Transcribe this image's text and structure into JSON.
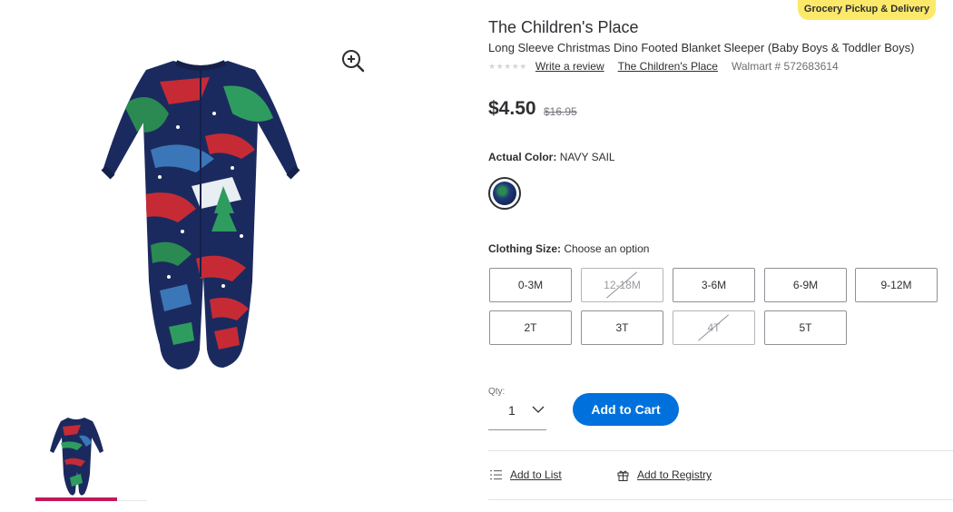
{
  "badges": {
    "grocery": "Grocery Pickup & Delivery"
  },
  "product": {
    "brand": "The Children's Place",
    "title": "Long Sleeve Christmas Dino Footed Blanket Sleeper (Baby Boys & Toddler Boys)",
    "rating_stars": "★★★★★",
    "write_review": "Write a review",
    "brand_link": "The Children's Place",
    "walmart_number": "Walmart # 572683614"
  },
  "pricing": {
    "price": "$4.50",
    "was_price": "$16.95"
  },
  "color": {
    "label": "Actual Color:",
    "value": "NAVY SAIL"
  },
  "size": {
    "label": "Clothing Size:",
    "value": "Choose an option",
    "options": [
      {
        "label": "0-3M",
        "available": true
      },
      {
        "label": "12-18M",
        "available": false
      },
      {
        "label": "3-6M",
        "available": true
      },
      {
        "label": "6-9M",
        "available": true
      },
      {
        "label": "9-12M",
        "available": true
      },
      {
        "label": "2T",
        "available": true
      },
      {
        "label": "3T",
        "available": true
      },
      {
        "label": "4T",
        "available": false
      },
      {
        "label": "5T",
        "available": true
      }
    ]
  },
  "quantity": {
    "label": "Qty:",
    "value": "1"
  },
  "actions": {
    "add_to_cart": "Add to Cart",
    "add_to_list": "Add to List",
    "add_to_registry": "Add to Registry"
  },
  "colors": {
    "primary_blue": "#0071dc",
    "badge_yellow": "#fce96a",
    "thumb_active": "#c2185b"
  },
  "icons": {
    "zoom": "zoom-in-icon",
    "chevron": "chevron-down-icon",
    "list": "list-icon",
    "registry": "gift-icon"
  }
}
